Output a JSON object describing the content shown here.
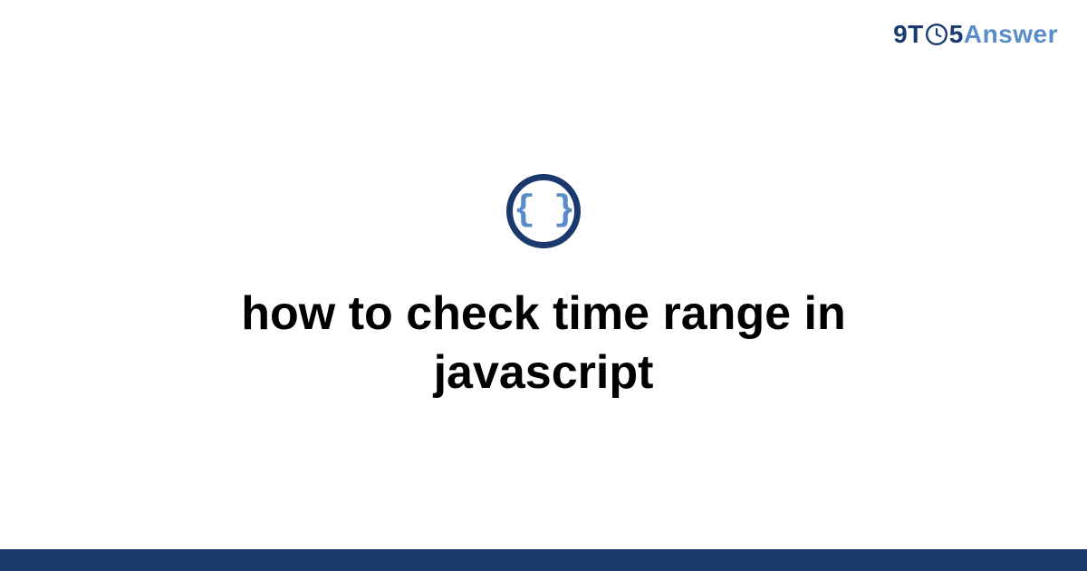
{
  "logo": {
    "nine_t": "9T",
    "five": "5",
    "answer": "Answer"
  },
  "icon": {
    "semantic": "code-braces-icon",
    "glyph": "{ }"
  },
  "title": "how to check time range in javascript",
  "colors": {
    "brand_dark": "#1a3a6e",
    "brand_light": "#5a8cc9",
    "background": "#ffffff",
    "title_text": "#000000"
  }
}
